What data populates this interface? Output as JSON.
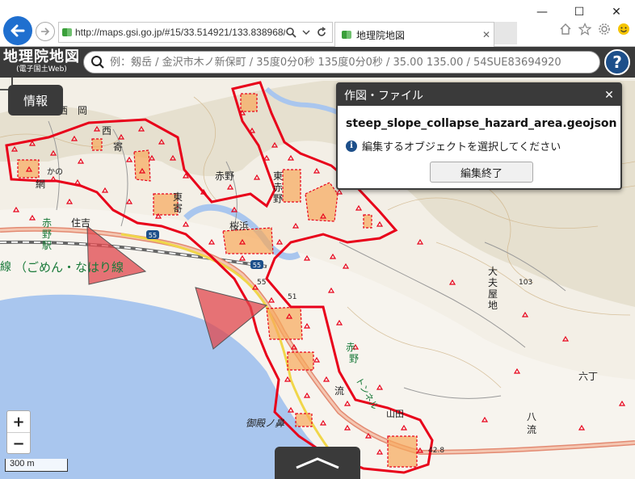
{
  "browser": {
    "url": "http://maps.gsi.go.jp/#15/33.514921/133.838968/",
    "tab_title": "地理院地図",
    "tab_close": "✕",
    "win_minimize": "—",
    "win_maximize": "☐",
    "win_close": "✕"
  },
  "header": {
    "logo_main": "地理院地図",
    "logo_sub": "(電子国土Web)",
    "search_placeholder": "例：剱岳 / 金沢市木ノ新保町 / 35度0分0秒 135度0分0秒 / 35.00 135.00 / 54SUE83694920",
    "help_label": "?"
  },
  "info_button": {
    "label": "情報"
  },
  "panel": {
    "title": "作図・ファイル",
    "close": "✕",
    "filename": "steep_slope_collapse_hazard_area.geojson",
    "message": "編集するオブジェクトを選択してください",
    "info_glyph": "i",
    "finish_button": "編集終了"
  },
  "map": {
    "labels": [
      {
        "t": "西　岡"
      },
      {
        "t": "西"
      },
      {
        "t": "寄"
      },
      {
        "t": "かの"
      },
      {
        "t": "網"
      },
      {
        "t": "赤野"
      },
      {
        "t": "東"
      },
      {
        "t": "寄"
      },
      {
        "t": "東"
      },
      {
        "t": "赤"
      },
      {
        "t": "野"
      },
      {
        "t": "桜浜"
      },
      {
        "t": "赤"
      },
      {
        "t": "野"
      },
      {
        "t": "駅"
      },
      {
        "t": "住吉"
      },
      {
        "t": "線"
      },
      {
        "t": "（ごめん・なはり線"
      },
      {
        "t": "55"
      },
      {
        "t": "51"
      },
      {
        "t": "大"
      },
      {
        "t": "夫"
      },
      {
        "t": "屋"
      },
      {
        "t": "地"
      },
      {
        "t": "103"
      },
      {
        "t": "流"
      },
      {
        "t": "六丁"
      },
      {
        "t": "八"
      },
      {
        "t": "流"
      },
      {
        "t": "御殿ノ鼻"
      },
      {
        "t": "山田"
      },
      {
        "t": "42.8"
      },
      {
        "t": "赤"
      },
      {
        "t": "野"
      },
      {
        "t": "トンネル"
      }
    ],
    "route_number": "55",
    "route_number2": "55",
    "scale_label": "300 m",
    "zoom_in": "+",
    "zoom_out": "−",
    "colors": {
      "sea": "#a9c6ee",
      "hazard_outline": "#e8001a",
      "hazard_fill": "#f7a85a",
      "triangle_fill": "#e0474c"
    }
  }
}
